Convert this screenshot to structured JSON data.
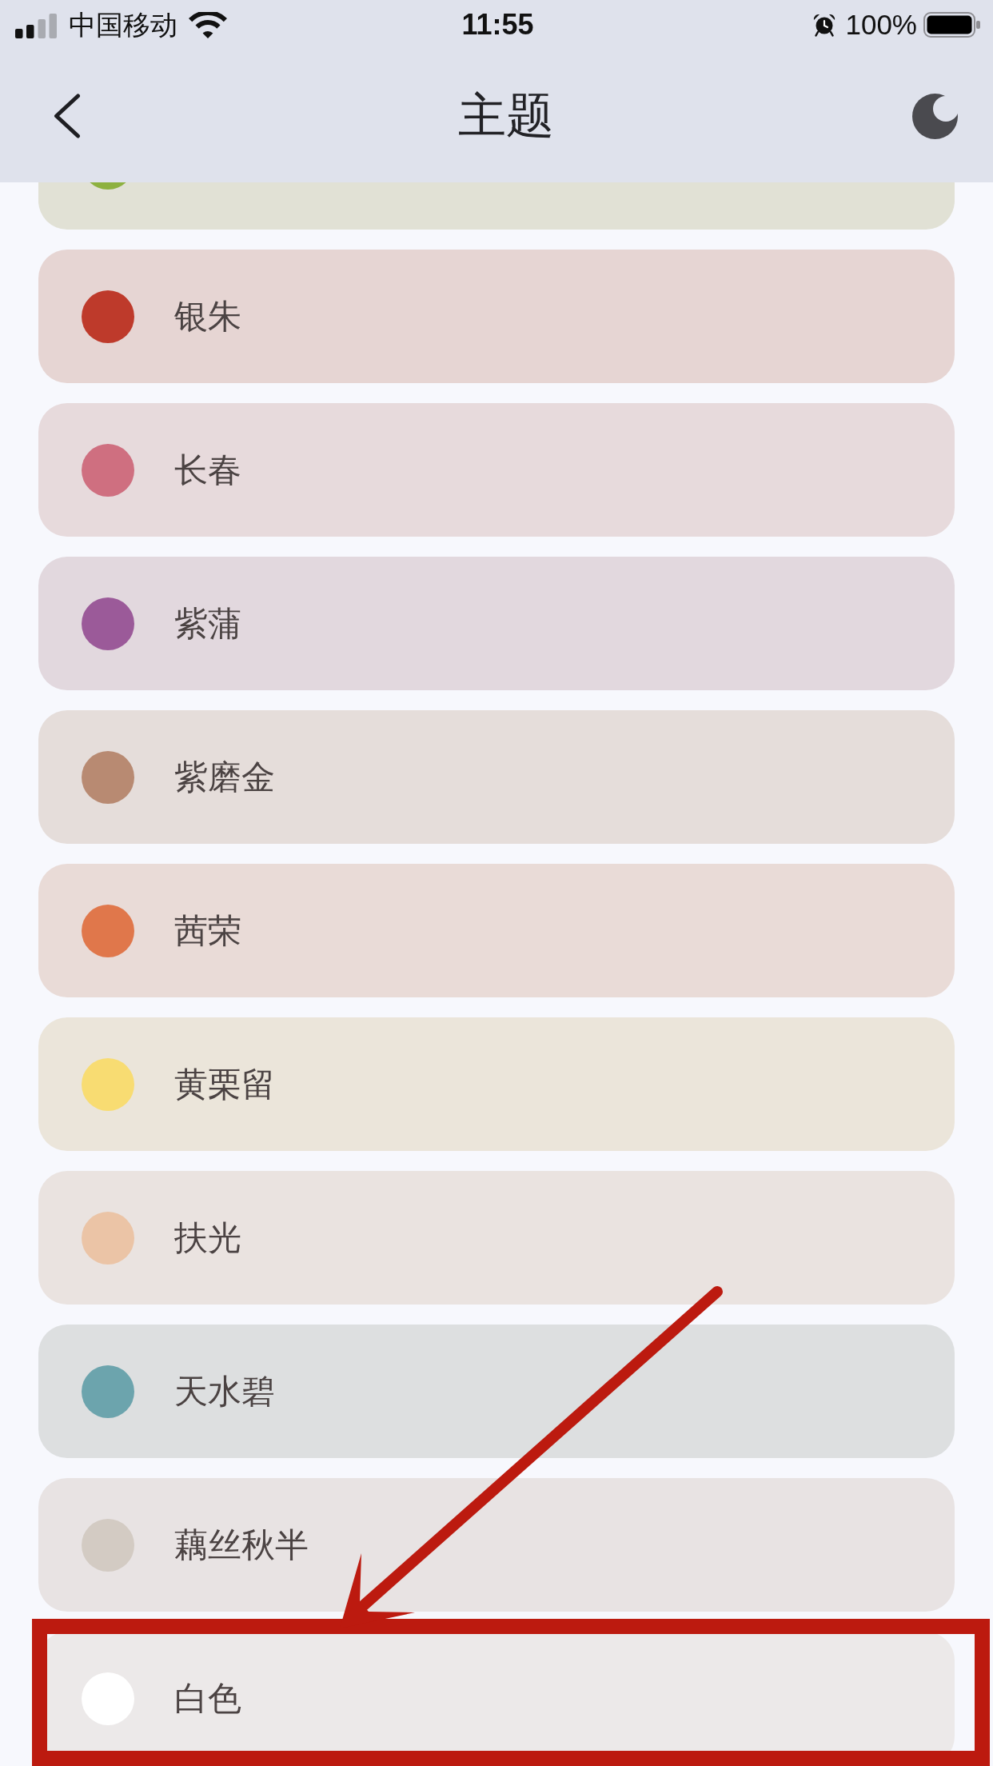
{
  "status_bar": {
    "carrier": "中国移动",
    "time": "11:55",
    "battery": "100%"
  },
  "nav_bar": {
    "title": "主题"
  },
  "partial_item": {
    "color": "#8db13f"
  },
  "items": [
    {
      "label": "银朱",
      "color": "#be3a2b",
      "highlighted": false
    },
    {
      "label": "长春",
      "color": "#cf6f80",
      "highlighted": false
    },
    {
      "label": "紫蒲",
      "color": "#9b5a99",
      "highlighted": false
    },
    {
      "label": "紫磨金",
      "color": "#b88a72",
      "highlighted": false
    },
    {
      "label": "茜荣",
      "color": "#e0774b",
      "highlighted": false
    },
    {
      "label": "黄栗留",
      "color": "#f8dc72",
      "highlighted": false
    },
    {
      "label": "扶光",
      "color": "#ebc4a6",
      "highlighted": false
    },
    {
      "label": "天水碧",
      "color": "#6ca4ad",
      "highlighted": false
    },
    {
      "label": "藕丝秋半",
      "color": "#d3cbc3",
      "highlighted": false
    },
    {
      "label": "白色",
      "color": "#ffffff",
      "highlighted": true
    }
  ]
}
